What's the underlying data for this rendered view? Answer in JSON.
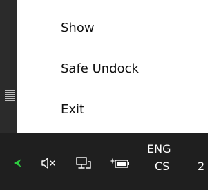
{
  "menu": {
    "items": [
      {
        "label": "Show"
      },
      {
        "label": "Safe Undock"
      },
      {
        "label": "Exit"
      }
    ]
  },
  "taskbar": {
    "input_language": "ENG",
    "keyboard_layout": "CS",
    "clock_partial": "2",
    "icons": [
      "chevron-up-icon",
      "volume-muted-icon",
      "network-icon",
      "battery-icon"
    ],
    "accent_color": "#2ecc40"
  }
}
